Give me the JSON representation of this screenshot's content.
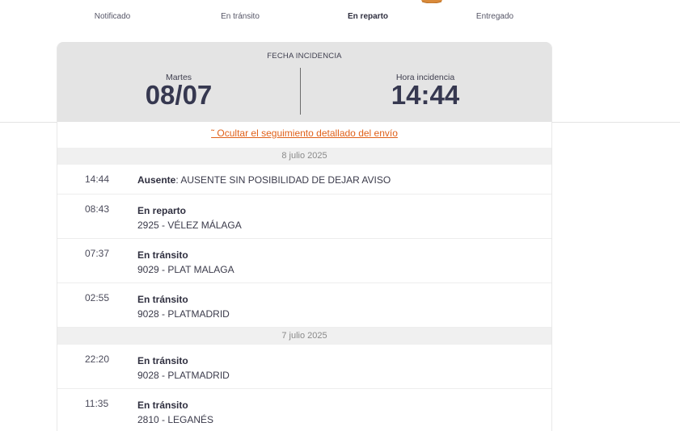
{
  "steps": [
    {
      "label": "Notificado",
      "active": false
    },
    {
      "label": "En tránsito",
      "active": false
    },
    {
      "label": "En reparto",
      "active": true
    },
    {
      "label": "Entregado",
      "active": false
    }
  ],
  "incident": {
    "title": "FECHA INCIDENCIA",
    "day_label": "Martes",
    "date": "08/07",
    "time_label": "Hora incidencia",
    "time": "14:44"
  },
  "toggle": {
    "label": "˜ Ocultar el seguimiento detallado del envío"
  },
  "groups": [
    {
      "date": "8 julio 2025",
      "events": [
        {
          "time": "14:44",
          "title": "Ausente",
          "sep": ":",
          "desc": " AUSENTE SIN POSIBILIDAD DE DEJAR AVISO",
          "inline": true
        },
        {
          "time": "08:43",
          "title": "En reparto",
          "desc": "2925 - VÉLEZ MÁLAGA",
          "inline": false
        },
        {
          "time": "07:37",
          "title": "En tránsito",
          "desc": "9029 - PLAT MALAGA",
          "inline": false
        },
        {
          "time": "02:55",
          "title": "En tránsito",
          "desc": "9028 - PLATMADRID",
          "inline": false
        }
      ]
    },
    {
      "date": "7 julio 2025",
      "events": [
        {
          "time": "22:20",
          "title": "En tránsito",
          "desc": "9028 - PLATMADRID",
          "inline": false
        },
        {
          "time": "11:35",
          "title": "En tránsito",
          "desc": "2810 - LEGANÉS",
          "inline": false
        }
      ]
    }
  ],
  "colors": {
    "accent": "#e0611a",
    "header_bg": "#e4e4e4",
    "date_row_bg": "#f0f0f0",
    "box_icon": "#d98a3a"
  },
  "icons": {
    "package": "package-icon"
  }
}
